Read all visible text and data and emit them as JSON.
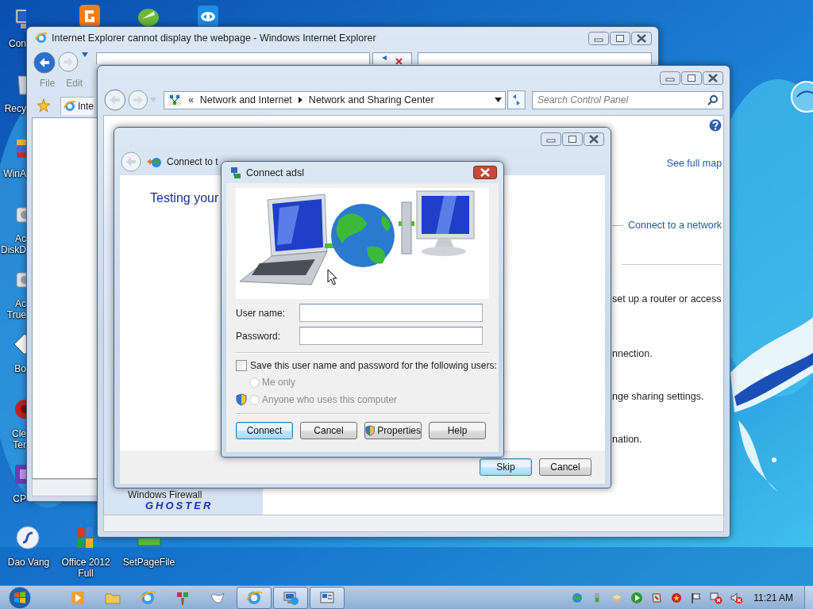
{
  "desktop": {
    "icons": [
      {
        "kind": "computer",
        "label": "Con"
      },
      {
        "kind": "recycle-bin",
        "label": "Recy"
      },
      {
        "kind": "archive",
        "label": "WinA"
      },
      {
        "kind": "disk",
        "label": "Ac DiskD"
      },
      {
        "kind": "disk",
        "label": "Ac True"
      },
      {
        "kind": "book",
        "label": "Bo"
      },
      {
        "kind": "cleaner",
        "label": "Cle Ter"
      },
      {
        "kind": "cp",
        "label": "CP"
      },
      {
        "kind": "orange-app"
      },
      {
        "kind": "green-app"
      },
      {
        "kind": "remote-app"
      },
      {
        "kind": "globe"
      },
      {
        "kind": "swirl",
        "label": "Dao Vang"
      },
      {
        "kind": "office",
        "label": "Office 2012 Full"
      },
      {
        "kind": "page-file",
        "label": "SetPageFile"
      }
    ]
  },
  "ie_window": {
    "title": "Internet Explorer cannot display the webpage - Windows Internet Explorer",
    "menu": [
      "File",
      "Edit"
    ],
    "tab": "Inte"
  },
  "cp_window": {
    "breadcrumb_overflow": "«",
    "breadcrumb": [
      "Network and Internet",
      "Network and Sharing Center"
    ],
    "search": {
      "placeholder": "Search Control Panel"
    },
    "links": [
      "See full map",
      "Connect to a network"
    ],
    "texts": [
      "set up a router or access",
      "nnection.",
      "nge sharing settings.",
      "nation."
    ],
    "sidebar": [
      "Windows Firewall"
    ],
    "logo": "GHOSTER"
  },
  "wizard": {
    "title": "Connect to t",
    "heading": "Testing your",
    "buttons": [
      {
        "label": "Skip",
        "default": true
      },
      {
        "label": "Cancel",
        "default": false
      }
    ]
  },
  "dialog": {
    "title": "Connect adsl",
    "fields": [
      {
        "label": "User name:"
      },
      {
        "label": "Password:"
      }
    ],
    "save": {
      "label": "Save this user name and password for the following users:",
      "checked": false
    },
    "options": [
      {
        "label": "Me only",
        "selected": false,
        "disabled": true,
        "shield": false
      },
      {
        "label": "Anyone who uses this computer",
        "selected": false,
        "disabled": true,
        "shield": true
      }
    ],
    "buttons": [
      {
        "label": "Connect",
        "default": true,
        "shield": false
      },
      {
        "label": "Cancel",
        "default": false,
        "shield": false
      },
      {
        "label": "Properties",
        "default": false,
        "shield": true
      },
      {
        "label": "Help",
        "default": false,
        "shield": false
      }
    ]
  },
  "taskbar": {
    "items": [
      {
        "kind": "media",
        "running": false
      },
      {
        "kind": "folder",
        "running": false
      },
      {
        "kind": "ie",
        "running": false
      },
      {
        "kind": "paint",
        "running": false
      },
      {
        "kind": "bird",
        "running": false
      },
      {
        "kind": "ie",
        "running": true
      },
      {
        "kind": "network",
        "running": true
      },
      {
        "kind": "dialog",
        "running": true
      }
    ],
    "clock": "11:21 AM"
  }
}
